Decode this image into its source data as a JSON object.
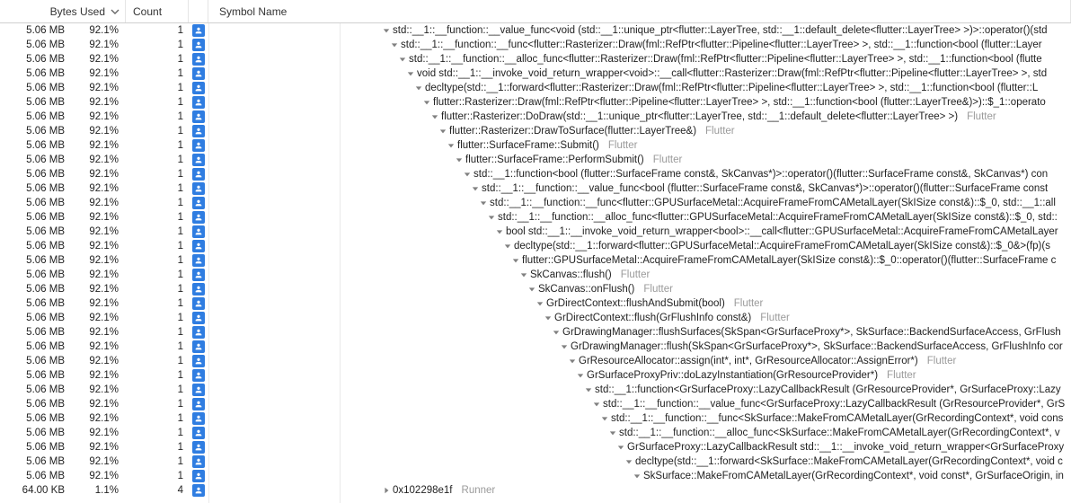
{
  "columns": {
    "bytes": "Bytes Used",
    "count": "Count",
    "symbol": "Symbol Name"
  },
  "base_indent": 21,
  "rows": [
    {
      "bytes": "5.06 MB",
      "pct": "92.1%",
      "count": "1",
      "indent": 0,
      "disclosure": "down",
      "symbol": "std::__1::__function::__value_func<void (std::__1::unique_ptr<flutter::LayerTree, std::__1::default_delete<flutter::LayerTree> >)>::operator()(std",
      "lib": ""
    },
    {
      "bytes": "5.06 MB",
      "pct": "92.1%",
      "count": "1",
      "indent": 1,
      "disclosure": "down",
      "symbol": "std::__1::__function::__func<flutter::Rasterizer::Draw(fml::RefPtr<flutter::Pipeline<flutter::LayerTree> >, std::__1::function<bool (flutter::Layer",
      "lib": ""
    },
    {
      "bytes": "5.06 MB",
      "pct": "92.1%",
      "count": "1",
      "indent": 2,
      "disclosure": "down",
      "symbol": "std::__1::__function::__alloc_func<flutter::Rasterizer::Draw(fml::RefPtr<flutter::Pipeline<flutter::LayerTree> >, std::__1::function<bool (flutte",
      "lib": ""
    },
    {
      "bytes": "5.06 MB",
      "pct": "92.1%",
      "count": "1",
      "indent": 3,
      "disclosure": "down",
      "symbol": "void std::__1::__invoke_void_return_wrapper<void>::__call<flutter::Rasterizer::Draw(fml::RefPtr<flutter::Pipeline<flutter::LayerTree> >, std",
      "lib": ""
    },
    {
      "bytes": "5.06 MB",
      "pct": "92.1%",
      "count": "1",
      "indent": 4,
      "disclosure": "down",
      "symbol": "decltype(std::__1::forward<flutter::Rasterizer::Draw(fml::RefPtr<flutter::Pipeline<flutter::LayerTree> >, std::__1::function<bool (flutter::L",
      "lib": ""
    },
    {
      "bytes": "5.06 MB",
      "pct": "92.1%",
      "count": "1",
      "indent": 5,
      "disclosure": "down",
      "symbol": "flutter::Rasterizer::Draw(fml::RefPtr<flutter::Pipeline<flutter::LayerTree> >, std::__1::function<bool (flutter::LayerTree&)>)::$_1::operato",
      "lib": ""
    },
    {
      "bytes": "5.06 MB",
      "pct": "92.1%",
      "count": "1",
      "indent": 6,
      "disclosure": "down",
      "symbol": "flutter::Rasterizer::DoDraw(std::__1::unique_ptr<flutter::LayerTree, std::__1::default_delete<flutter::LayerTree> >)",
      "lib": "Flutter"
    },
    {
      "bytes": "5.06 MB",
      "pct": "92.1%",
      "count": "1",
      "indent": 7,
      "disclosure": "down",
      "symbol": "flutter::Rasterizer::DrawToSurface(flutter::LayerTree&)",
      "lib": "Flutter"
    },
    {
      "bytes": "5.06 MB",
      "pct": "92.1%",
      "count": "1",
      "indent": 8,
      "disclosure": "down",
      "symbol": "flutter::SurfaceFrame::Submit()",
      "lib": "Flutter"
    },
    {
      "bytes": "5.06 MB",
      "pct": "92.1%",
      "count": "1",
      "indent": 9,
      "disclosure": "down",
      "symbol": "flutter::SurfaceFrame::PerformSubmit()",
      "lib": "Flutter"
    },
    {
      "bytes": "5.06 MB",
      "pct": "92.1%",
      "count": "1",
      "indent": 10,
      "disclosure": "down",
      "symbol": "std::__1::function<bool (flutter::SurfaceFrame const&, SkCanvas*)>::operator()(flutter::SurfaceFrame const&, SkCanvas*) con",
      "lib": ""
    },
    {
      "bytes": "5.06 MB",
      "pct": "92.1%",
      "count": "1",
      "indent": 11,
      "disclosure": "down",
      "symbol": "std::__1::__function::__value_func<bool (flutter::SurfaceFrame const&, SkCanvas*)>::operator()(flutter::SurfaceFrame const",
      "lib": ""
    },
    {
      "bytes": "5.06 MB",
      "pct": "92.1%",
      "count": "1",
      "indent": 12,
      "disclosure": "down",
      "symbol": "std::__1::__function::__func<flutter::GPUSurfaceMetal::AcquireFrameFromCAMetalLayer(SkISize const&)::$_0, std::__1::all",
      "lib": ""
    },
    {
      "bytes": "5.06 MB",
      "pct": "92.1%",
      "count": "1",
      "indent": 13,
      "disclosure": "down",
      "symbol": "std::__1::__function::__alloc_func<flutter::GPUSurfaceMetal::AcquireFrameFromCAMetalLayer(SkISize const&)::$_0, std::",
      "lib": ""
    },
    {
      "bytes": "5.06 MB",
      "pct": "92.1%",
      "count": "1",
      "indent": 14,
      "disclosure": "down",
      "symbol": "bool std::__1::__invoke_void_return_wrapper<bool>::__call<flutter::GPUSurfaceMetal::AcquireFrameFromCAMetalLayer",
      "lib": ""
    },
    {
      "bytes": "5.06 MB",
      "pct": "92.1%",
      "count": "1",
      "indent": 15,
      "disclosure": "down",
      "symbol": "decltype(std::__1::forward<flutter::GPUSurfaceMetal::AcquireFrameFromCAMetalLayer(SkISize const&)::$_0&>(fp)(s",
      "lib": ""
    },
    {
      "bytes": "5.06 MB",
      "pct": "92.1%",
      "count": "1",
      "indent": 16,
      "disclosure": "down",
      "symbol": "flutter::GPUSurfaceMetal::AcquireFrameFromCAMetalLayer(SkISize const&)::$_0::operator()(flutter::SurfaceFrame c",
      "lib": ""
    },
    {
      "bytes": "5.06 MB",
      "pct": "92.1%",
      "count": "1",
      "indent": 17,
      "disclosure": "down",
      "symbol": "SkCanvas::flush()",
      "lib": "Flutter"
    },
    {
      "bytes": "5.06 MB",
      "pct": "92.1%",
      "count": "1",
      "indent": 18,
      "disclosure": "down",
      "symbol": "SkCanvas::onFlush()",
      "lib": "Flutter"
    },
    {
      "bytes": "5.06 MB",
      "pct": "92.1%",
      "count": "1",
      "indent": 19,
      "disclosure": "down",
      "symbol": "GrDirectContext::flushAndSubmit(bool)",
      "lib": "Flutter"
    },
    {
      "bytes": "5.06 MB",
      "pct": "92.1%",
      "count": "1",
      "indent": 20,
      "disclosure": "down",
      "symbol": "GrDirectContext::flush(GrFlushInfo const&)",
      "lib": "Flutter"
    },
    {
      "bytes": "5.06 MB",
      "pct": "92.1%",
      "count": "1",
      "indent": 21,
      "disclosure": "down",
      "symbol": "GrDrawingManager::flushSurfaces(SkSpan<GrSurfaceProxy*>, SkSurface::BackendSurfaceAccess, GrFlush",
      "lib": ""
    },
    {
      "bytes": "5.06 MB",
      "pct": "92.1%",
      "count": "1",
      "indent": 22,
      "disclosure": "down",
      "symbol": "GrDrawingManager::flush(SkSpan<GrSurfaceProxy*>, SkSurface::BackendSurfaceAccess, GrFlushInfo cor",
      "lib": ""
    },
    {
      "bytes": "5.06 MB",
      "pct": "92.1%",
      "count": "1",
      "indent": 23,
      "disclosure": "down",
      "symbol": "GrResourceAllocator::assign(int*, int*, GrResourceAllocator::AssignError*)",
      "lib": "Flutter"
    },
    {
      "bytes": "5.06 MB",
      "pct": "92.1%",
      "count": "1",
      "indent": 24,
      "disclosure": "down",
      "symbol": "GrSurfaceProxyPriv::doLazyInstantiation(GrResourceProvider*)",
      "lib": "Flutter"
    },
    {
      "bytes": "5.06 MB",
      "pct": "92.1%",
      "count": "1",
      "indent": 25,
      "disclosure": "down",
      "symbol": "std::__1::function<GrSurfaceProxy::LazyCallbackResult (GrResourceProvider*, GrSurfaceProxy::Lazy",
      "lib": ""
    },
    {
      "bytes": "5.06 MB",
      "pct": "92.1%",
      "count": "1",
      "indent": 26,
      "disclosure": "down",
      "symbol": "std::__1::__function::__value_func<GrSurfaceProxy::LazyCallbackResult (GrResourceProvider*, GrS",
      "lib": ""
    },
    {
      "bytes": "5.06 MB",
      "pct": "92.1%",
      "count": "1",
      "indent": 27,
      "disclosure": "down",
      "symbol": "std::__1::__function::__func<SkSurface::MakeFromCAMetalLayer(GrRecordingContext*, void cons",
      "lib": ""
    },
    {
      "bytes": "5.06 MB",
      "pct": "92.1%",
      "count": "1",
      "indent": 28,
      "disclosure": "down",
      "symbol": "std::__1::__function::__alloc_func<SkSurface::MakeFromCAMetalLayer(GrRecordingContext*, v",
      "lib": ""
    },
    {
      "bytes": "5.06 MB",
      "pct": "92.1%",
      "count": "1",
      "indent": 29,
      "disclosure": "down",
      "symbol": "GrSurfaceProxy::LazyCallbackResult std::__1::__invoke_void_return_wrapper<GrSurfaceProxy",
      "lib": ""
    },
    {
      "bytes": "5.06 MB",
      "pct": "92.1%",
      "count": "1",
      "indent": 30,
      "disclosure": "down",
      "symbol": "decltype(std::__1::forward<SkSurface::MakeFromCAMetalLayer(GrRecordingContext*, void c",
      "lib": ""
    },
    {
      "bytes": "5.06 MB",
      "pct": "92.1%",
      "count": "1",
      "indent": 31,
      "disclosure": "down",
      "symbol": "SkSurface::MakeFromCAMetalLayer(GrRecordingContext*, void const*, GrSurfaceOrigin, in",
      "lib": ""
    },
    {
      "bytes": "64.00 KB",
      "pct": "1.1%",
      "count": "4",
      "indent": 0,
      "disclosure": "right",
      "symbol": "0x102298e1f",
      "lib": "Runner"
    }
  ]
}
